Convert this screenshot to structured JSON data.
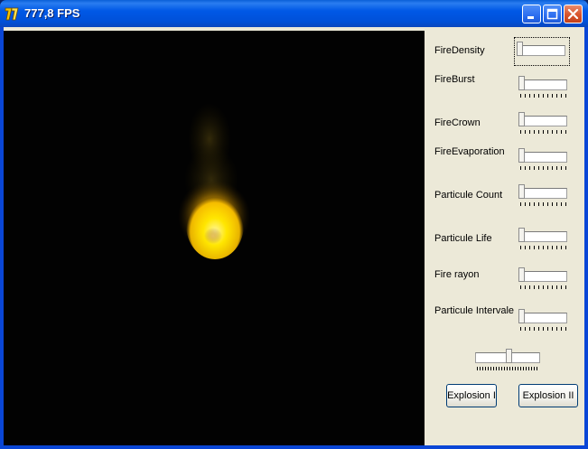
{
  "window": {
    "title": "777,8 FPS"
  },
  "controls": {
    "sliders": [
      {
        "label": "FireDensity"
      },
      {
        "label": "FireBurst"
      },
      {
        "label": "FireCrown"
      },
      {
        "label": "FireEvaporation"
      },
      {
        "label": "Particule Count"
      },
      {
        "label": "Particule Life"
      },
      {
        "label": "Fire rayon"
      },
      {
        "label": "Particule Intervale"
      }
    ],
    "explosion1_label": "Explosion I",
    "explosion2_label": "Explosion II"
  },
  "colors": {
    "titlebar": "#0058e6",
    "scene_background": "#020202",
    "panel": "#ece9d8",
    "flame": "#ffd600"
  }
}
